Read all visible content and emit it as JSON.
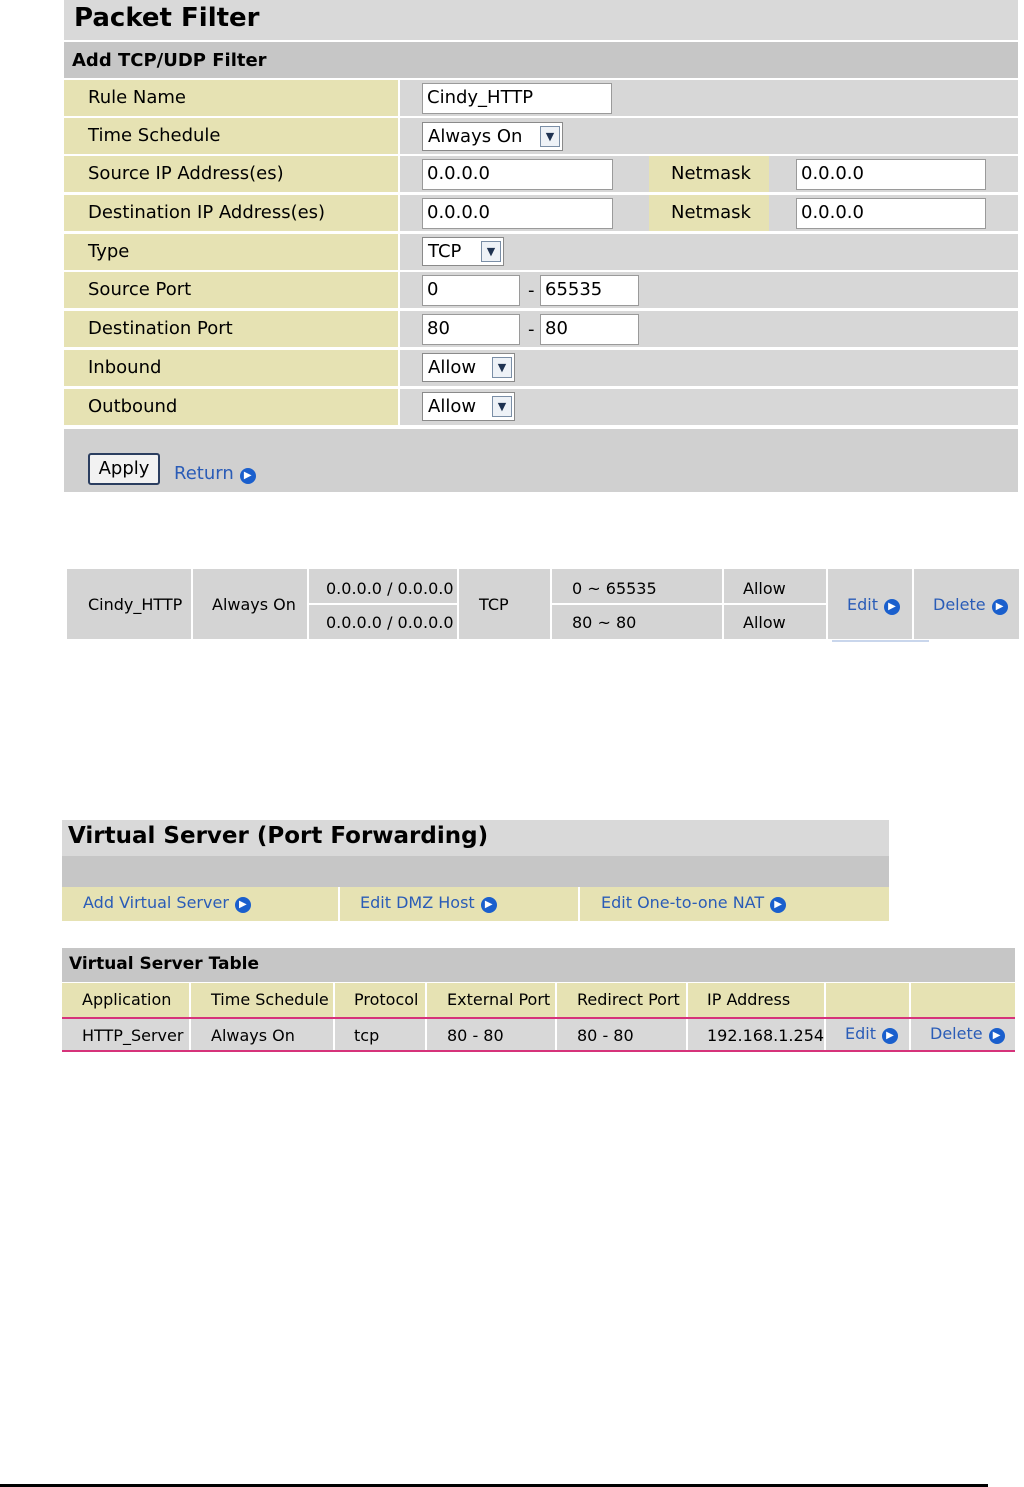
{
  "packet_filter": {
    "title": "Packet Filter",
    "subtitle": "Add TCP/UDP Filter",
    "rows": {
      "rule_name": {
        "label": "Rule Name",
        "value": "Cindy_HTTP"
      },
      "time_schedule": {
        "label": "Time Schedule",
        "value": "Always On"
      },
      "source_ip": {
        "label": "Source IP Address(es)",
        "value": "0.0.0.0",
        "netmask_label": "Netmask",
        "netmask": "0.0.0.0"
      },
      "dest_ip": {
        "label": "Destination IP Address(es)",
        "value": "0.0.0.0",
        "netmask_label": "Netmask",
        "netmask": "0.0.0.0"
      },
      "type": {
        "label": "Type",
        "value": "TCP"
      },
      "source_port": {
        "label": "Source Port",
        "from": "0",
        "sep": "-",
        "to": "65535"
      },
      "dest_port": {
        "label": "Destination Port",
        "from": "80",
        "sep": "-",
        "to": "80"
      },
      "inbound": {
        "label": "Inbound",
        "value": "Allow"
      },
      "outbound": {
        "label": "Outbound",
        "value": "Allow"
      }
    },
    "apply_label": "Apply",
    "return_label": "Return"
  },
  "rule_summary": {
    "name": "Cindy_HTTP",
    "schedule": "Always On",
    "src": "0.0.0.0 / 0.0.0.0",
    "dst": "0.0.0.0 / 0.0.0.0",
    "type": "TCP",
    "src_ports": "0 ~ 65535",
    "dst_ports": "80 ~ 80",
    "inbound": "Allow",
    "outbound": "Allow",
    "edit": "Edit",
    "delete": "Delete"
  },
  "virtual_server": {
    "title": "Virtual Server (Port Forwarding)",
    "links": [
      "Add Virtual Server",
      "Edit DMZ Host",
      "Edit One-to-one NAT"
    ],
    "table_title": "Virtual Server Table",
    "columns": [
      "Application",
      "Time Schedule",
      "Protocol",
      "External Port",
      "Redirect Port",
      "IP Address"
    ],
    "row": {
      "application": "HTTP_Server",
      "schedule": "Always On",
      "protocol": "tcp",
      "external": "80 - 80",
      "redirect": "80 - 80",
      "ip": "192.168.1.254",
      "edit": "Edit",
      "delete": "Delete"
    }
  },
  "colors": {
    "label_bg": "#e6e2b3",
    "header_bg": "#c6c6c6",
    "link": "#2a5cb7",
    "highlight": "#d6337a"
  }
}
